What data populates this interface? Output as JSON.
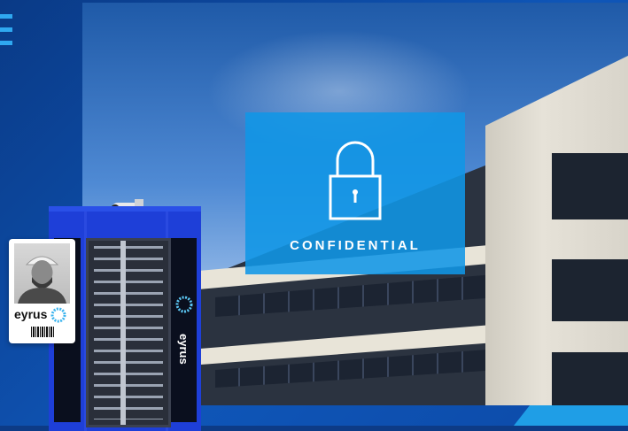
{
  "overlay": {
    "label": "CONFIDENTIAL",
    "icon": "lock-icon"
  },
  "container": {
    "brand": "eyrus",
    "brand_icon": "eyrus-logo-icon"
  },
  "badge": {
    "brand": "eyrus",
    "brand_icon": "eyrus-logo-icon"
  },
  "colors": {
    "background": "#0d3b86",
    "overlay": "#1096e6",
    "container": "#1e3fd8",
    "accent": "#1f9ee6"
  }
}
